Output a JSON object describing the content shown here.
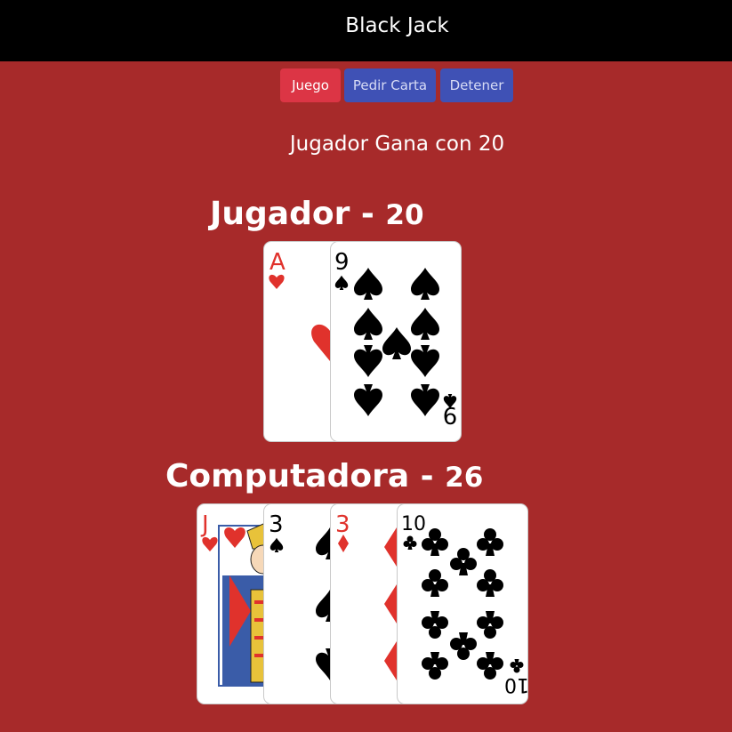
{
  "app": {
    "title": "Black Jack"
  },
  "buttons": {
    "new_game": "Juego",
    "hit": "Pedir Carta",
    "stand": "Detener"
  },
  "status": {
    "message": "Jugador Gana con 20"
  },
  "player": {
    "label": "Jugador -",
    "score": "20",
    "cards": [
      {
        "rank": "A",
        "suit": "hearts",
        "color": "#e0322c"
      },
      {
        "rank": "9",
        "suit": "spades",
        "color": "#000000"
      }
    ]
  },
  "computer": {
    "label": "Computadora -",
    "score": "26",
    "cards": [
      {
        "rank": "J",
        "suit": "hearts",
        "color": "#e0322c"
      },
      {
        "rank": "3",
        "suit": "spades",
        "color": "#000000"
      },
      {
        "rank": "3",
        "suit": "diamonds",
        "color": "#e0322c"
      },
      {
        "rank": "10",
        "suit": "clubs",
        "color": "#000000"
      }
    ]
  }
}
